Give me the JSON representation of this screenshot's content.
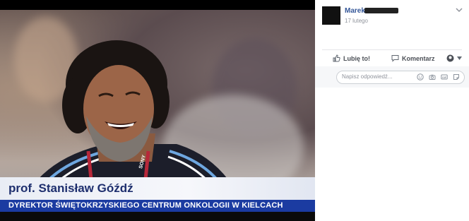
{
  "video": {
    "name_caption": "prof. Stanisław Góźdź",
    "title_caption": "DYREKTOR ŚWIĘTOKRZYSKIEGO CENTRUM ONKOLOGII W KIELCACH",
    "lanyard_text": "SONY"
  },
  "comment": {
    "author": "Marek",
    "time": "17 lutego"
  },
  "actions": {
    "like_label": "Lubię to!",
    "comment_label": "Komentarz"
  },
  "reply": {
    "placeholder": "Napisz odpowiedź..."
  },
  "colors": {
    "caption_blue": "#1b3ba1",
    "link_blue": "#365899"
  }
}
